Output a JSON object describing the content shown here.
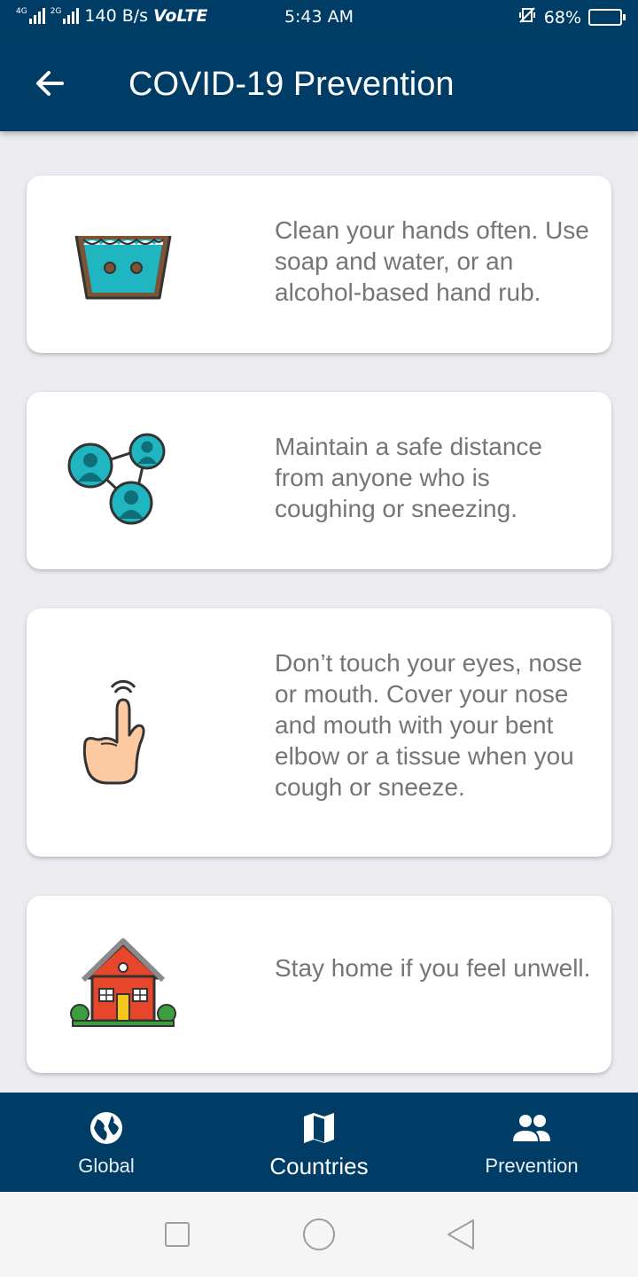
{
  "status_bar": {
    "network_4g": "4G",
    "network_2g": "2G",
    "speed": "140 B/s",
    "volte": "VoLTE",
    "time": "5:43 AM",
    "battery_percent": "68%",
    "battery_level": 0.68
  },
  "app_bar": {
    "title": "COVID-19 Prevention",
    "back_icon": "arrow-left-icon"
  },
  "cards": [
    {
      "icon": "handwash-basin-icon",
      "text": "Clean your hands often. Use soap and water, or an alcohol-based hand rub."
    },
    {
      "icon": "people-distance-icon",
      "text": "Maintain a safe distance from anyone who is coughing or sneezing."
    },
    {
      "icon": "finger-touch-icon",
      "text": "Don’t touch your eyes, nose or mouth. Cover your nose and mouth with your bent elbow or a tissue when you cough or sneeze."
    },
    {
      "icon": "house-icon",
      "text": "Stay home if you feel unwell."
    }
  ],
  "bottom_nav": {
    "items": [
      {
        "label": "Global",
        "icon": "globe-icon"
      },
      {
        "label": "Countries",
        "icon": "map-icon"
      },
      {
        "label": "Prevention",
        "icon": "people-icon"
      }
    ],
    "active_index": 1
  },
  "colors": {
    "primary": "#003d66",
    "background": "#ebebf0",
    "card_text": "#757575",
    "teal": "#1fb5c1"
  }
}
